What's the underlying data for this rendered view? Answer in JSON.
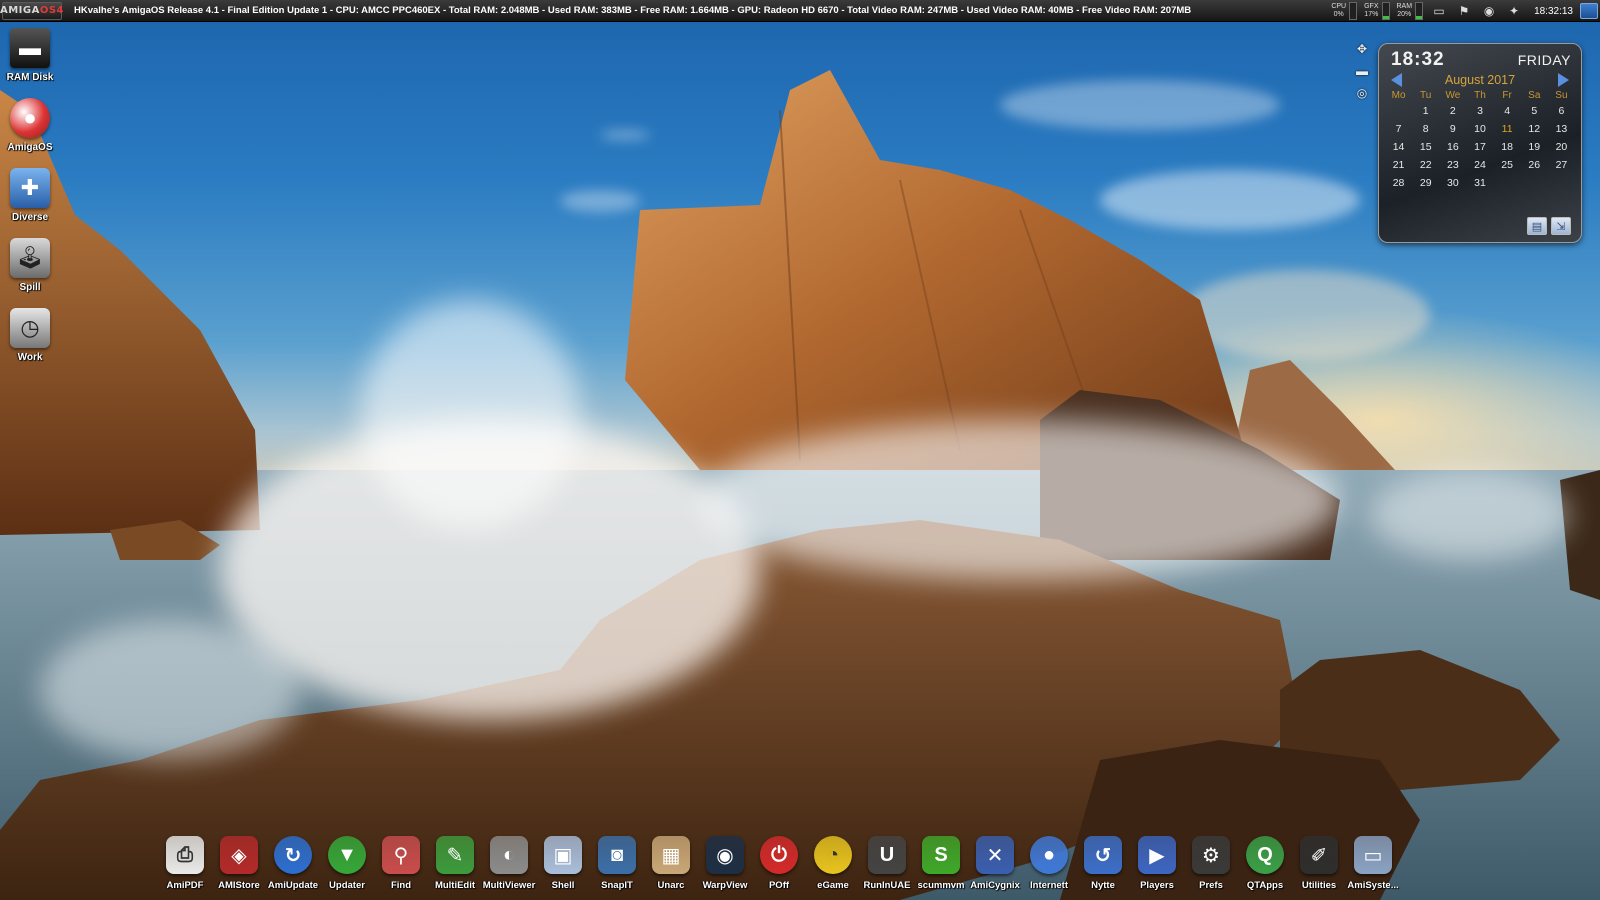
{
  "topbar": {
    "logo_part1": "AMIGA",
    "logo_part2": "OS4",
    "title": "HKvalhe's AmigaOS Release 4.1 - Final Edition Update 1 - CPU: AMCC PPC460EX - Total RAM: 2.048MB - Used RAM: 383MB - Free RAM: 1.664MB - GPU: Radeon HD 6670 - Total Video RAM: 247MB - Used Video RAM: 40MB - Free Video RAM: 207MB",
    "meters": [
      {
        "name": "CPU",
        "value": "0%",
        "fraction": 0.0
      },
      {
        "name": "GFX",
        "value": "17%",
        "fraction": 0.17
      },
      {
        "name": "RAM",
        "value": "20%",
        "fraction": 0.2
      }
    ],
    "tray_icons": [
      "monitor-icon",
      "flag-icon",
      "disk-icon",
      "amiga-icon"
    ],
    "clock": "18:32:13"
  },
  "desktop_icons": [
    {
      "label": "RAM Disk",
      "icon": "ram-disk-icon"
    },
    {
      "label": "AmigaOS",
      "icon": "boing-ball-icon"
    },
    {
      "label": "Diverse",
      "icon": "drawer-plus-icon"
    },
    {
      "label": "Spill",
      "icon": "joystick-icon"
    },
    {
      "label": "Work",
      "icon": "clock-drive-icon"
    }
  ],
  "calendar": {
    "time": "18:32",
    "weekday": "FRIDAY",
    "month": "August 2017",
    "days_of_week": [
      "Mo",
      "Tu",
      "We",
      "Th",
      "Fr",
      "Sa",
      "Su"
    ],
    "weeks": [
      [
        "",
        "1",
        "2",
        "3",
        "4",
        "5",
        "6"
      ],
      [
        "7",
        "8",
        "9",
        "10",
        "11",
        "12",
        "13"
      ],
      [
        "14",
        "15",
        "16",
        "17",
        "18",
        "19",
        "20"
      ],
      [
        "21",
        "22",
        "23",
        "24",
        "25",
        "26",
        "27"
      ],
      [
        "28",
        "29",
        "30",
        "31",
        "",
        "",
        ""
      ]
    ],
    "today": "11",
    "accent": "#d7a33a"
  },
  "dock": [
    {
      "label": "AmiPDF",
      "icon": "pdf-icon",
      "color": "#e9e9e9"
    },
    {
      "label": "AMIStore",
      "icon": "shopping-bag-icon",
      "color": "#b32a2a"
    },
    {
      "label": "AmiUpdate",
      "icon": "update-icon",
      "color": "#2c6fd1"
    },
    {
      "label": "Updater",
      "icon": "down-arrow-icon",
      "color": "#35a839"
    },
    {
      "label": "Find",
      "icon": "find-icon",
      "color": "#c94d4d"
    },
    {
      "label": "MultiEdit",
      "icon": "notepad-icon",
      "color": "#3d9b3d"
    },
    {
      "label": "MultiViewer",
      "icon": "speaker-icon",
      "color": "#8c8c8c"
    },
    {
      "label": "Shell",
      "icon": "shell-icon",
      "color": "#a9bedb"
    },
    {
      "label": "SnapIT",
      "icon": "camera-icon",
      "color": "#3b6fa8"
    },
    {
      "label": "Unarc",
      "icon": "archive-icon",
      "color": "#c9a777"
    },
    {
      "label": "WarpView",
      "icon": "eye-icon",
      "color": "#1d2f45"
    },
    {
      "label": "POff",
      "icon": "power-icon",
      "color": "#d42a2a"
    },
    {
      "label": "eGame",
      "icon": "pacman-icon",
      "color": "#e8c41e"
    },
    {
      "label": "RunInUAE",
      "icon": "uae-icon",
      "color": "#444444"
    },
    {
      "label": "scummvm",
      "icon": "scumm-icon",
      "color": "#3fa82a"
    },
    {
      "label": "AmiCygnix",
      "icon": "cygnix-icon",
      "color": "#3a5fb0"
    },
    {
      "label": "Internett",
      "icon": "globe-icon",
      "color": "#3f78d6"
    },
    {
      "label": "Nytte",
      "icon": "undo-icon",
      "color": "#3c6fc9"
    },
    {
      "label": "Players",
      "icon": "players-icon",
      "color": "#3d66c2"
    },
    {
      "label": "Prefs",
      "icon": "prefs-icon",
      "color": "#3a3a3a"
    },
    {
      "label": "QTApps",
      "icon": "qt-icon",
      "color": "#3aa048"
    },
    {
      "label": "Utilities",
      "icon": "utilities-icon",
      "color": "#2e2e2e"
    },
    {
      "label": "AmiSyste...",
      "icon": "monitor-icon",
      "color": "#8aa3c4"
    }
  ]
}
